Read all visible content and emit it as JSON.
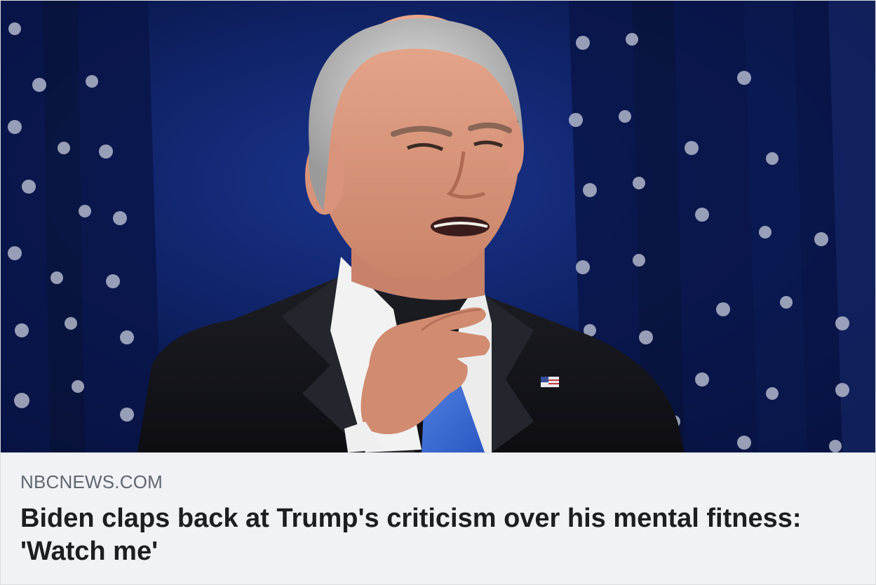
{
  "link_preview": {
    "domain": "NBCNEWS.COM",
    "headline": "Biden claps back at Trump's criticism over his mental fitness: 'Watch me'",
    "image_icon": "photo-of-speaker-pointing",
    "colors": {
      "caption_background": "#f0f2f5",
      "domain_text": "#606770",
      "headline_text": "#1c1e21",
      "photo_background": "#0b1a47"
    }
  }
}
